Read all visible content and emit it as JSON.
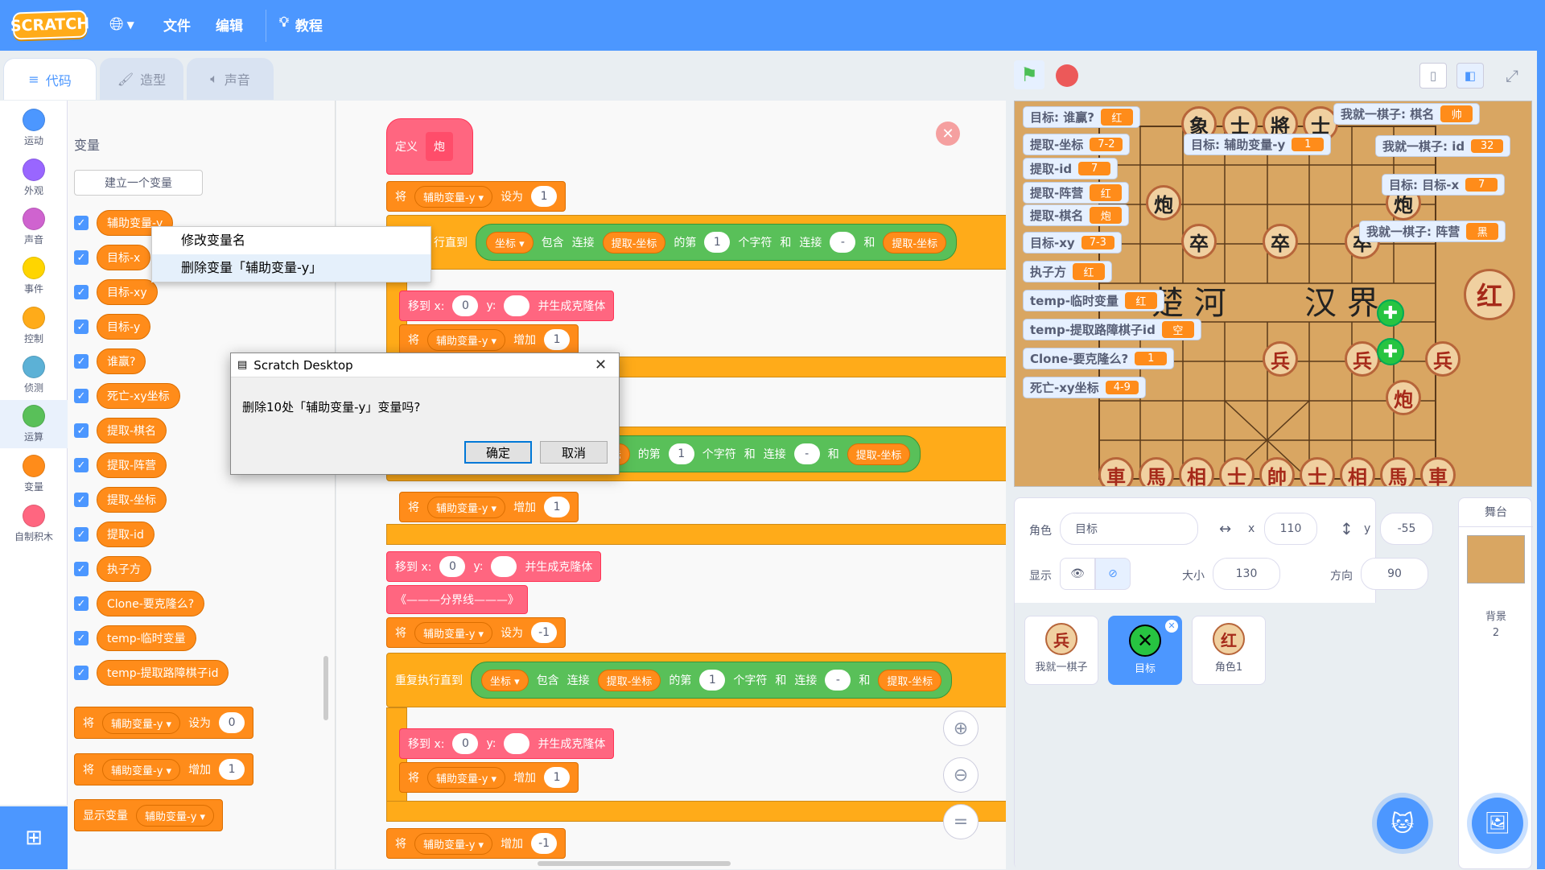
{
  "menu": {
    "logo": "SCRATCH",
    "language_icon": "globe-icon",
    "file": "文件",
    "edit": "编辑",
    "tutorials": "教程"
  },
  "tabs": [
    {
      "label": "代码"
    },
    {
      "label": "造型"
    },
    {
      "label": "声音"
    }
  ],
  "categories": [
    {
      "label": "运动",
      "color": "#4c97ff"
    },
    {
      "label": "外观",
      "color": "#9966ff"
    },
    {
      "label": "声音",
      "color": "#cf63cf"
    },
    {
      "label": "事件",
      "color": "#ffd500"
    },
    {
      "label": "控制",
      "color": "#ffab19"
    },
    {
      "label": "侦测",
      "color": "#5cb1d6"
    },
    {
      "label": "运算",
      "color": "#59c059"
    },
    {
      "label": "变量",
      "color": "#ff8c1a"
    },
    {
      "label": "自制积木",
      "color": "#ff6680"
    }
  ],
  "palette": {
    "section": "变量",
    "make_var": "建立一个变量",
    "variables": [
      "辅助变量-y",
      "目标-x",
      "目标-xy",
      "目标-y",
      "谁赢?",
      "死亡-xy坐标",
      "提取-棋名",
      "提取-阵营",
      "提取-坐标",
      "提取-id",
      "执子方",
      "Clone-要克隆么?",
      "temp-临时变量",
      "temp-提取路障棋子id"
    ],
    "set_block": {
      "verb": "将",
      "var": "辅助变量-y",
      "op": "设为",
      "val": "0"
    },
    "change_block": {
      "verb": "将",
      "var": "辅助变量-y",
      "op": "增加",
      "val": "1"
    },
    "show_block": {
      "verb": "显示变量",
      "var": "辅助变量-y"
    }
  },
  "context_menu": {
    "rename": "修改变量名",
    "delete": "删除变量「辅助变量-y」"
  },
  "dialog": {
    "title": "Scratch Desktop",
    "message": "删除10处「辅助变量-y」变量吗?",
    "ok": "确定",
    "cancel": "取消"
  },
  "script": {
    "define": "定义",
    "define_name": "炮",
    "set": "将",
    "set_op": "设为",
    "change_op": "增加",
    "var": "辅助变量-y",
    "repeat_until": "重复执行直到",
    "repeat_until_short": "行直到",
    "coord": "坐标",
    "contains": "包含",
    "join": "连接",
    "get_coord": "提取-坐标",
    "nth": "的第",
    "char": "个字符",
    "and": "和",
    "dash": "-",
    "goto_x": "移到 x:",
    "goto_y": "y:",
    "clone": "并生成克隆体",
    "divider": "《———分界线———》",
    "v1": "1",
    "v0": "0",
    "vneg": "-1",
    "change_partial": "将"
  },
  "stage_monitors": [
    {
      "label": "目标: 谁赢?",
      "value": "红"
    },
    {
      "label": "提取-坐标",
      "value": "7-2"
    },
    {
      "label": "提取-id",
      "value": "7"
    },
    {
      "label": "提取-阵营",
      "value": "红"
    },
    {
      "label": "提取-棋名",
      "value": "炮"
    },
    {
      "label": "目标-xy",
      "value": "7-3"
    },
    {
      "label": "执子方",
      "value": "红"
    },
    {
      "label": "temp-临时变量",
      "value": "红"
    },
    {
      "label": "temp-提取路障棋子id",
      "value": "空"
    },
    {
      "label": "Clone-要克隆么?",
      "value": "1"
    },
    {
      "label": "死亡-xy坐标",
      "value": "4-9"
    },
    {
      "label": "目标: 辅助变量-y",
      "value": "1"
    },
    {
      "label": "我就一棋子: 棋名",
      "value": "帅"
    },
    {
      "label": "我就一棋子: id",
      "value": "32"
    },
    {
      "label": "目标: 目标-x",
      "value": "7"
    },
    {
      "label": "我就一棋子: 阵营",
      "value": "黑"
    }
  ],
  "board": {
    "river_left": "楚 河",
    "river_right": "汉 界",
    "badge": "红",
    "top_row": [
      "象",
      "士",
      "將",
      "士"
    ],
    "black_pieces": [
      "炮",
      "卒",
      "卒",
      "卒",
      "炮"
    ],
    "red_soldiers": [
      "兵",
      "兵",
      "兵"
    ],
    "red_cannon": "炮",
    "bottom_row": [
      "車",
      "馬",
      "相",
      "士",
      "帥",
      "士",
      "相",
      "馬",
      "車"
    ]
  },
  "sprite_info": {
    "sprite_label": "角色",
    "sprite_name": "目标",
    "x_label": "x",
    "x": "110",
    "y_label": "y",
    "y": "-55",
    "show_label": "显示",
    "size_label": "大小",
    "size": "130",
    "dir_label": "方向",
    "dir": "90"
  },
  "sprites": [
    {
      "name": "我就一棋子",
      "glyph": "兵"
    },
    {
      "name": "目标",
      "glyph": "✕"
    },
    {
      "name": "角色1",
      "glyph": "红"
    }
  ],
  "stage_panel": {
    "title": "舞台",
    "backdrop_label": "背景",
    "backdrop_count": "2"
  }
}
